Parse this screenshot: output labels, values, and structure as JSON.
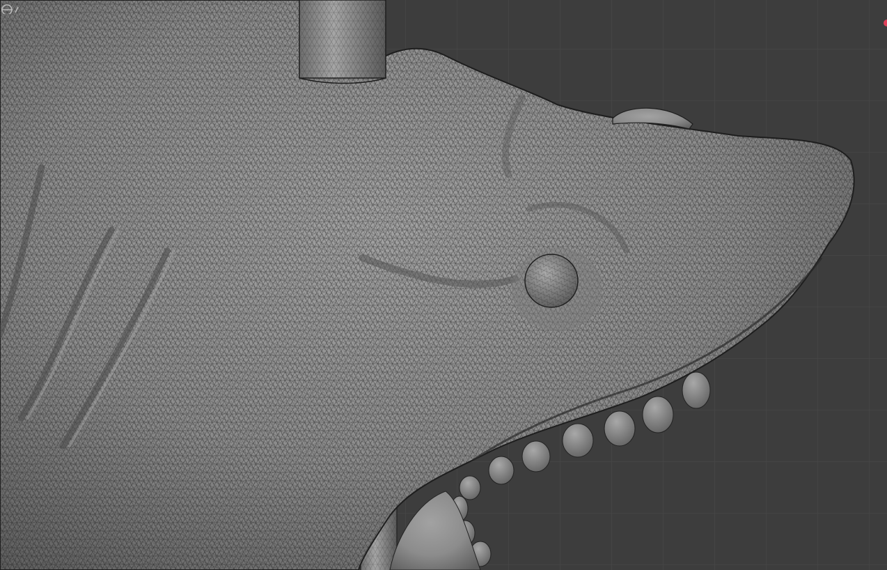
{
  "viewport": {
    "background_color": "#3d3d3d",
    "grid_color": "#4a4a4a",
    "mesh_color": "#8f8f8f",
    "wire_color": "#1e1e1e",
    "record_indicator_color": "#e0405a",
    "view_mode": "wireframe-overlay",
    "object": "shark-head-sculpt"
  }
}
